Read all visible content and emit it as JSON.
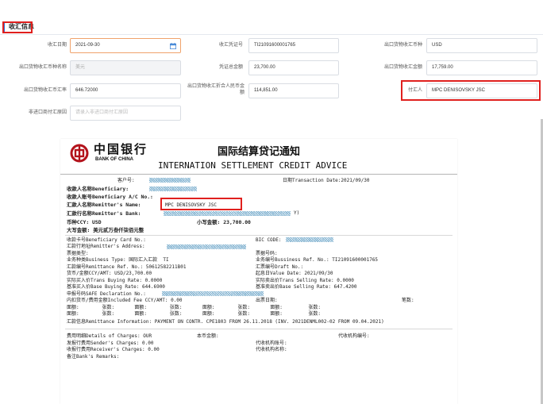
{
  "section": {
    "title": "收汇信息"
  },
  "form": {
    "receive_date": {
      "label": "收汇日期",
      "value": "2021-09-30"
    },
    "voucher_no": {
      "label": "收汇凭证号",
      "value": "TI21091600001765"
    },
    "export_currency": {
      "label": "出口货物收汇币种",
      "value": "USD"
    },
    "export_currency_name": {
      "label": "出口货物收汇币种名称",
      "value": "美元"
    },
    "voucher_total": {
      "label": "凭证总金额",
      "value": "23,700.00"
    },
    "export_amount": {
      "label": "出口货物收汇金额",
      "value": "17,759.00"
    },
    "export_rate": {
      "label": "出口货物收汇币汇率",
      "value": "646.72000"
    },
    "export_rmb": {
      "label": "出口货物收汇折合人民币金额",
      "value": "114,851.00"
    },
    "payer": {
      "label": "付汇人",
      "value": "MPC DENISOVSKY JSC"
    },
    "non_payer_reason": {
      "label": "非进口商付汇原因",
      "placeholder": "请录入非进口商付汇原因"
    }
  },
  "doc": {
    "bank_cn": "中国银行",
    "bank_en": "BANK OF CHINA",
    "title_cn": "国际结算贷记通知",
    "title_en": "INTERNATION SETTLEMENT CREDIT ADVICE",
    "customer_no": "客户号:",
    "date": "日期Transaction Date:2021/09/30",
    "beneficiary": "收款人名称Beneficiary:",
    "beneficiary_ac": "收款人账号Beneficiary A/C No.:",
    "remitter_name": "汇款人名称Remitter's Name:",
    "remitter_name_value": "MPC DENISOVSKY JSC",
    "remitter_bank": "汇款行名称Remitter's Bank:",
    "remitter_bank_tail": "Y)",
    "currency": "币种CCY: USD",
    "small_amount": "小写金额: 23,700.00",
    "big_amount": "大写金额: 美元贰万叁仟柒佰元整",
    "card_no": "收款卡号Beneficiary Card No.:",
    "bic": "BIC CODE:",
    "remitter_addr": "汇款行地址Remitter's Address:",
    "bill_type": "票据类型:",
    "bill_no": "票据号码:",
    "biz_type": "业务种类Business Type: 国际汇入汇款  TI",
    "biz_ref": "业务编号Bussiness Ref. No.: TI21091600001765",
    "remit_ref": "汇款编号Remittance Ref. No.: 50612582211B01",
    "draft_no": "汇票编号Draft No.:",
    "ccy_amt": "货币/金额CCY/AMT: USD/23,700.00",
    "value_date": "起息日Value Date: 2021/09/30",
    "buy_rate": "实际买入价Trans Buying Rate: 0.0000",
    "sell_rate": "实际卖出价Trans Selling Rate: 0.0000",
    "base_buy": "基准买入价Base Buying Rate: 644.6900",
    "base_sell": "基准卖出价Base Selling Rate: 647.4200",
    "safe_no": "申报号码SAFE Declaration No.:",
    "fee": "内扣货币/费用金额Included Fee CCY/AMT: 0.00",
    "out_date": "出票日期:",
    "bill_count": "笔数:",
    "face_row1": "面额:        张数:       面额:        张数:       面额:        张数:       面额:         张数:",
    "face_row2": "面额:        张数:       面额:        张数:       面额:        张数:       面额:         张数:",
    "remit_info": "汇款信息Remittance Information: PAYMENT ON CONTR. CPE1803 FROM 26.11.2018 (INV. 2021DENML002-02 FROM 09.04.2021)",
    "charges_detail": "费用明细Details of Charges: OUR",
    "local_amount": "本币金额:",
    "agent_no": "代收机构编号:",
    "sender_charges": "发报行费用Sender's Charges: 0.00",
    "agent_acct": "代收机构账号:",
    "receiver_charges": "收报行费用Receiver's Charges: 0.00",
    "agent_name": "代收机构名称:",
    "remarks": "备注Bank's Remarks:"
  }
}
